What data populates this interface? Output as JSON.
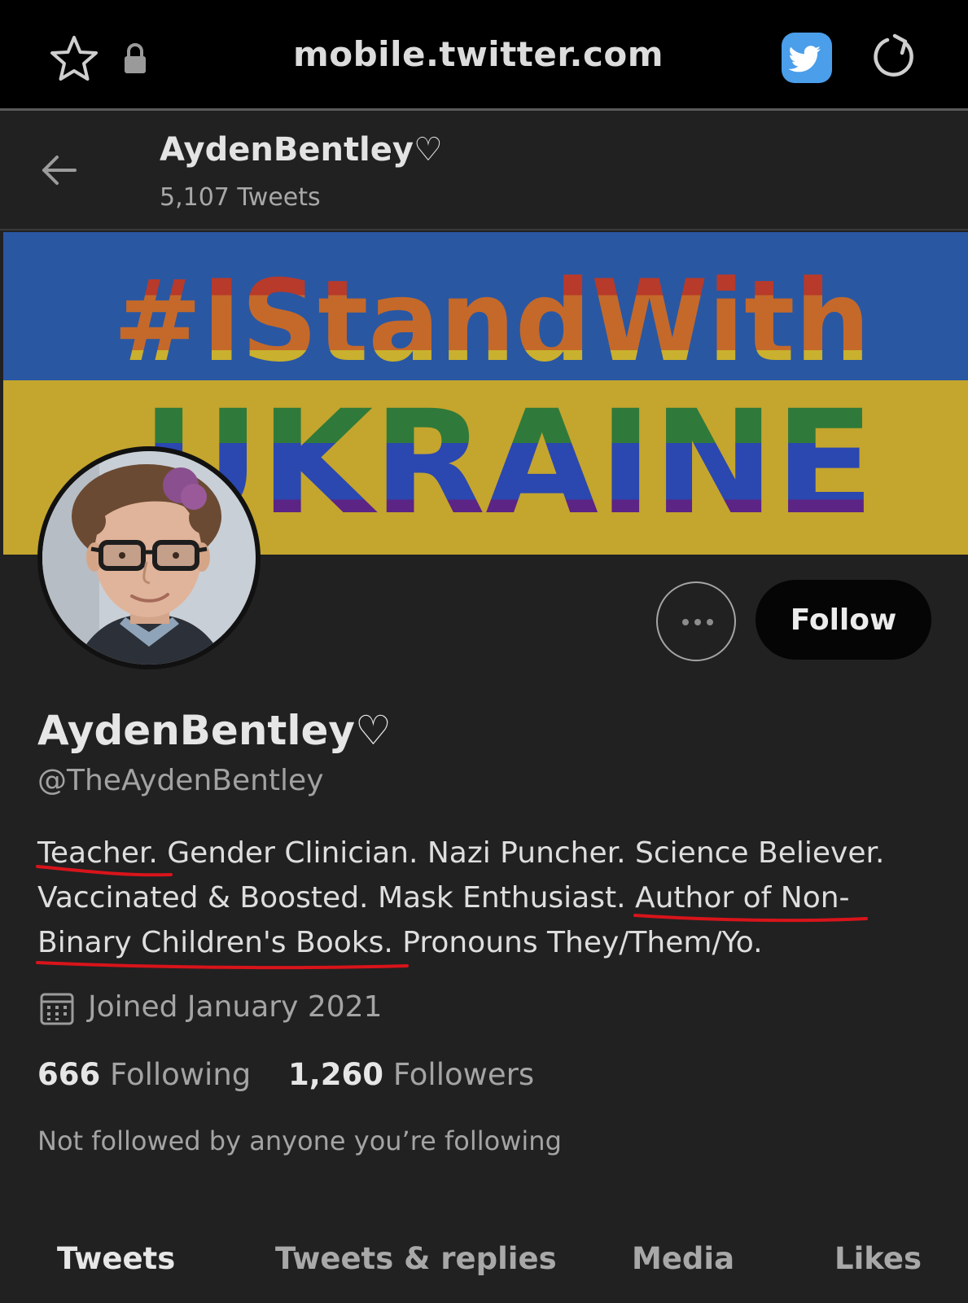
{
  "browser": {
    "url": "mobile.twitter.com",
    "icons": [
      "star-icon",
      "lock-icon",
      "twitter-bird-icon",
      "reload-icon"
    ]
  },
  "header": {
    "name": "AydenBentley♡",
    "tweet_count": "5,107 Tweets"
  },
  "banner": {
    "line1": "#IStandWith",
    "line2": "UKRAINE",
    "colors": {
      "blue": "#2a5aa8",
      "yellow": "#c7a72c"
    }
  },
  "actions": {
    "more_label": "•••",
    "follow_label": "Follow"
  },
  "profile": {
    "display_name": "AydenBentley♡",
    "handle": "@TheAydenBentley",
    "bio_line1": "Teacher. Gender Clinician. Nazi Puncher. Science Believer.",
    "bio_line2": "Vaccinated & Boosted. Mask Enthusiast. Author of Non-",
    "bio_line3": "Binary Children's Books. Pronouns They/Them/Yo.",
    "joined": "Joined January 2021",
    "following_count": "666",
    "following_label": "Following",
    "followers_count": "1,260",
    "followers_label": "Followers",
    "not_followed": "Not followed by anyone you’re following"
  },
  "tabs": [
    {
      "label": "Tweets",
      "active": true
    },
    {
      "label": "Tweets & replies",
      "active": false
    },
    {
      "label": "Media",
      "active": false
    },
    {
      "label": "Likes",
      "active": false
    }
  ],
  "annotation_color": "#d8141a"
}
